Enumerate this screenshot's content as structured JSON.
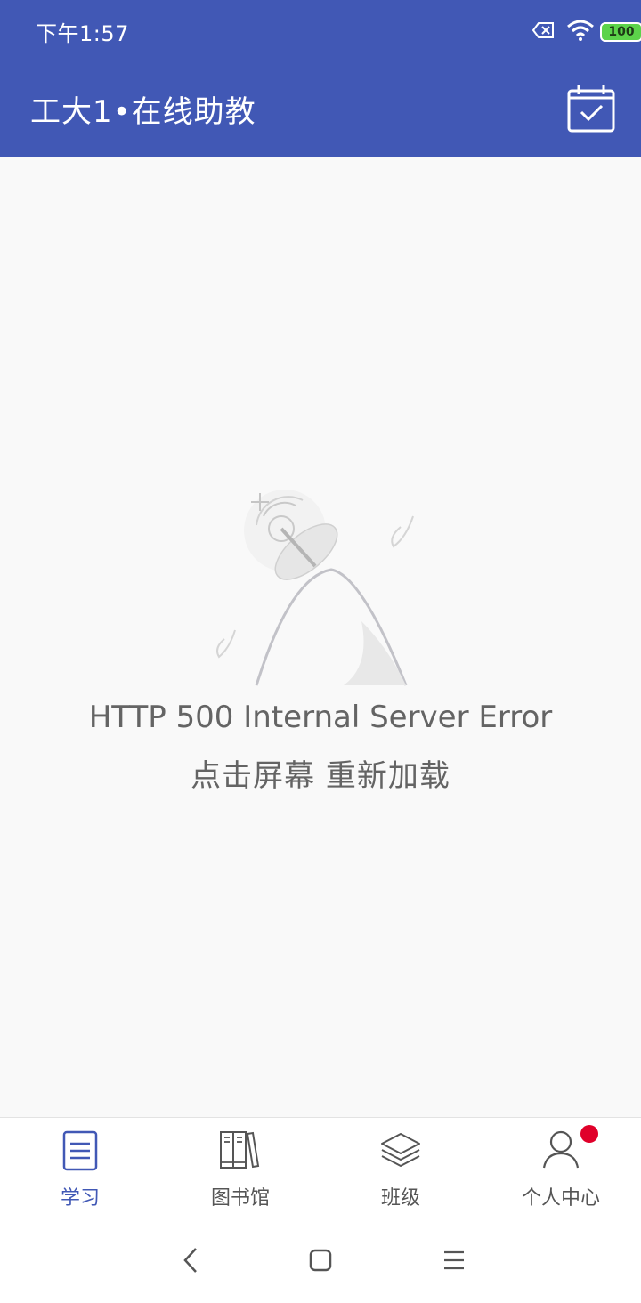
{
  "status_bar": {
    "time": "下午1:57",
    "battery_level": "100",
    "battery_color": "#5cd34a",
    "icons": [
      "sim-missing-icon",
      "wifi-icon",
      "battery-icon"
    ]
  },
  "app_bar": {
    "title": "工大1•在线助教",
    "background": "#4158b5",
    "action_icon": "calendar-check-icon"
  },
  "error": {
    "illustration": "satellite-dish-icon",
    "title": "HTTP 500 Internal Server Error",
    "hint": "点击屏幕 重新加载"
  },
  "bottom_nav": {
    "active_color": "#4158b5",
    "items": [
      {
        "label": "学习",
        "icon": "document-list-icon",
        "active": true
      },
      {
        "label": "图书馆",
        "icon": "books-icon",
        "active": false
      },
      {
        "label": "班级",
        "icon": "layers-icon",
        "active": false
      },
      {
        "label": "个人中心",
        "icon": "person-icon",
        "active": false,
        "badge": true
      }
    ]
  },
  "system_nav": {
    "buttons": [
      "back-icon",
      "home-icon",
      "menu-icon"
    ]
  }
}
